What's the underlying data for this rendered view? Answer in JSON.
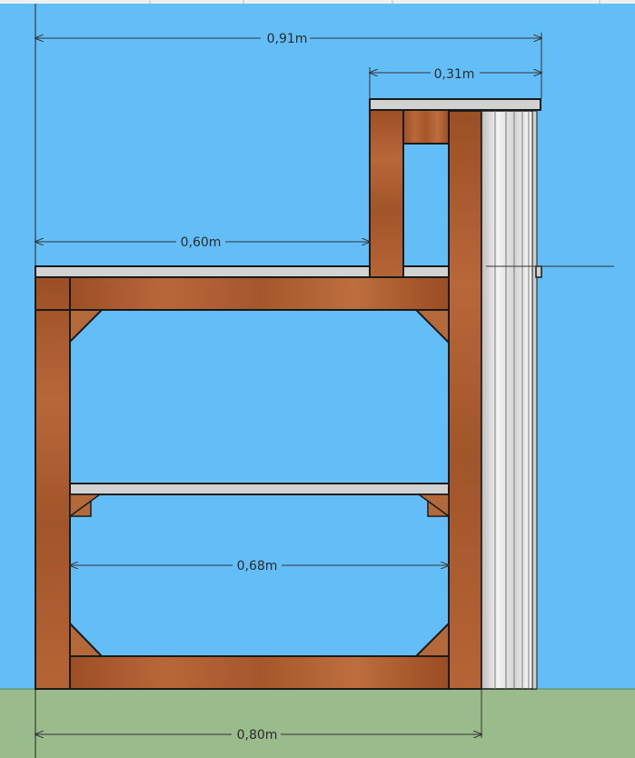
{
  "colors": {
    "sky": "#63bef8",
    "ground": "#9abb8c",
    "wood": "#a8592b",
    "wood_light": "#b96a38",
    "board": "#d2d2d2",
    "outline": "#1a1a1a",
    "dimension_line": "#333333"
  },
  "dimensions": {
    "total_width": "0,91m",
    "upper_width": "0,31m",
    "deck_width": "0,60m",
    "inner_width": "0,68m",
    "base_width": "0,80m"
  }
}
